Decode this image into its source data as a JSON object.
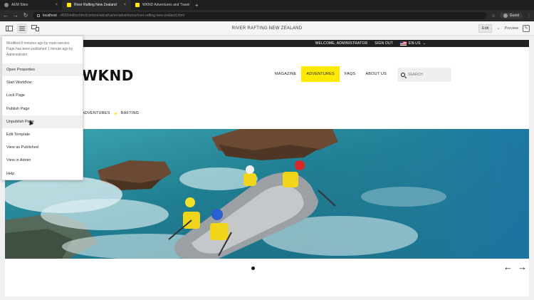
{
  "browser": {
    "tabs": [
      {
        "label": "AEM Sites",
        "active": false
      },
      {
        "label": "River Rafting New Zealand",
        "active": true
      },
      {
        "label": "WKND Adventures and Travel",
        "active": false
      }
    ],
    "new_tab": "+",
    "url_host": "localhost",
    "url_path": ":4502/editor.html/content/wknd/us/en/adventures/river-rafting-new-zealand.html",
    "guest_label": "Guest"
  },
  "toolbar": {
    "page_title": "RIVER RAFTING NEW ZEALAND",
    "edit_label": "Edit",
    "preview_label": "Preview"
  },
  "page_info_menu": {
    "info_text": "Modified 8 minutes ago by main-service. Page has been published 1 minute ago by Administrator",
    "items": [
      "Open Properties",
      "Start Workflow",
      "Lock Page",
      "Publish Page",
      "Unpublish Page",
      "Edit Template",
      "View as Published",
      "View in Admin",
      "Help"
    ]
  },
  "site": {
    "welcome": "WELCOME, ADMINISTRATOR",
    "sign_out": "SIGN OUT",
    "language": "EN-US",
    "logo": "WKND",
    "nav": [
      "MAGAZINE",
      "ADVENTURES",
      "FAQS",
      "ABOUT US"
    ],
    "active_nav": "ADVENTURES",
    "search_placeholder": "SEARCH",
    "breadcrumb": [
      "ADVENTURES",
      "RAFTING"
    ]
  },
  "colors": {
    "accent_yellow": "#ffea00",
    "top_strip": "#202020"
  }
}
